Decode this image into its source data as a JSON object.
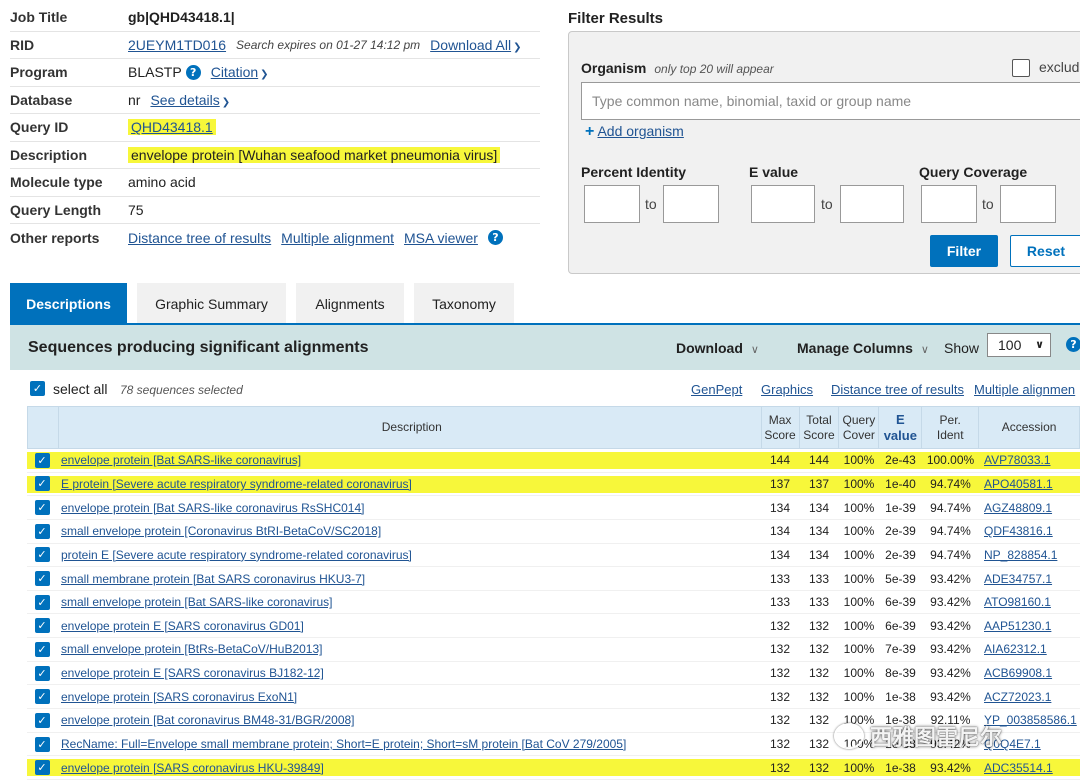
{
  "job": {
    "rows": [
      {
        "label": "Job Title",
        "value": "gb|QHD43418.1|"
      },
      {
        "label": "RID",
        "value": "2UEYM1TD016",
        "note": "Search expires on 01-27 14:12 pm",
        "link": "Download All"
      },
      {
        "label": "Program",
        "value": "BLASTP",
        "link": "Citation"
      },
      {
        "label": "Database",
        "value": "nr",
        "link": "See details"
      },
      {
        "label": "Query ID",
        "value": "QHD43418.1"
      },
      {
        "label": "Description",
        "value": "envelope protein [Wuhan seafood market pneumonia virus]"
      },
      {
        "label": "Molecule type",
        "value": "amino acid"
      },
      {
        "label": "Query Length",
        "value": "75"
      },
      {
        "label": "Other reports",
        "links": [
          "Distance tree of results",
          "Multiple alignment",
          "MSA viewer"
        ]
      }
    ]
  },
  "filter": {
    "title": "Filter Results",
    "organism_label": "Organism",
    "organism_note": "only top 20 will appear",
    "exclude_label": "exclud",
    "organism_placeholder": "Type common  name, binomial, taxid or group  name",
    "add_organism": "Add organism",
    "percent_identity": "Percent Identity",
    "e_value": "E value",
    "query_coverage": "Query Coverage",
    "to": "to",
    "filter_btn": "Filter",
    "reset_btn": "Reset"
  },
  "tabs": [
    "Descriptions",
    "Graphic Summary",
    "Alignments",
    "Taxonomy"
  ],
  "results": {
    "title": "Sequences producing significant alignments",
    "download": "Download",
    "manage_columns": "Manage Columns",
    "show_label": "Show",
    "show_value": "100",
    "select_all": "select all",
    "selected_count": "78 sequences selected",
    "links": [
      "GenPept",
      "Graphics",
      "Distance tree of results",
      "Multiple alignmen"
    ]
  },
  "columns": {
    "description": "Description",
    "max_score": [
      "Max",
      "Score"
    ],
    "total_score": [
      "Total",
      "Score"
    ],
    "query_cover": [
      "Query",
      "Cover"
    ],
    "e_value": [
      "E",
      "value"
    ],
    "per_ident": [
      "Per.",
      "Ident"
    ],
    "accession": "Accession"
  },
  "rows": [
    {
      "desc": "envelope protein [Bat SARS-like coronavirus]",
      "max": "144",
      "total": "144",
      "cover": "100%",
      "e": "2e-43",
      "ident": "100.00%",
      "acc": "AVP78033.1",
      "hl": true
    },
    {
      "desc": "E protein [Severe acute respiratory syndrome-related coronavirus]",
      "max": "137",
      "total": "137",
      "cover": "100%",
      "e": "1e-40",
      "ident": "94.74%",
      "acc": "APO40581.1",
      "hl": true
    },
    {
      "desc": "envelope protein [Bat SARS-like coronavirus RsSHC014]",
      "max": "134",
      "total": "134",
      "cover": "100%",
      "e": "1e-39",
      "ident": "94.74%",
      "acc": "AGZ48809.1",
      "hl": false
    },
    {
      "desc": "small envelope protein [Coronavirus BtRI-BetaCoV/SC2018]",
      "max": "134",
      "total": "134",
      "cover": "100%",
      "e": "2e-39",
      "ident": "94.74%",
      "acc": "QDF43816.1",
      "hl": false
    },
    {
      "desc": "protein E [Severe acute respiratory syndrome-related coronavirus]",
      "max": "134",
      "total": "134",
      "cover": "100%",
      "e": "2e-39",
      "ident": "94.74%",
      "acc": "NP_828854.1",
      "hl": false
    },
    {
      "desc": "small membrane protein [Bat SARS coronavirus HKU3-7]",
      "max": "133",
      "total": "133",
      "cover": "100%",
      "e": "5e-39",
      "ident": "93.42%",
      "acc": "ADE34757.1",
      "hl": false
    },
    {
      "desc": "small envelope protein [Bat SARS-like coronavirus]",
      "max": "133",
      "total": "133",
      "cover": "100%",
      "e": "6e-39",
      "ident": "93.42%",
      "acc": "ATO98160.1",
      "hl": false
    },
    {
      "desc": "envelope protein E [SARS coronavirus GD01]",
      "max": "132",
      "total": "132",
      "cover": "100%",
      "e": "6e-39",
      "ident": "93.42%",
      "acc": "AAP51230.1",
      "hl": false
    },
    {
      "desc": "small envelope protein [BtRs-BetaCoV/HuB2013]",
      "max": "132",
      "total": "132",
      "cover": "100%",
      "e": "7e-39",
      "ident": "93.42%",
      "acc": "AIA62312.1",
      "hl": false
    },
    {
      "desc": "envelope protein E [SARS coronavirus BJ182-12]",
      "max": "132",
      "total": "132",
      "cover": "100%",
      "e": "8e-39",
      "ident": "93.42%",
      "acc": "ACB69908.1",
      "hl": false
    },
    {
      "desc": "envelope protein [SARS coronavirus ExoN1]",
      "max": "132",
      "total": "132",
      "cover": "100%",
      "e": "1e-38",
      "ident": "93.42%",
      "acc": "ACZ72023.1",
      "hl": false
    },
    {
      "desc": "envelope protein [Bat coronavirus BM48-31/BGR/2008]",
      "max": "132",
      "total": "132",
      "cover": "100%",
      "e": "1e-38",
      "ident": "92.11%",
      "acc": "YP_003858586.1",
      "hl": false
    },
    {
      "desc": "RecName: Full=Envelope small membrane protein; Short=E protein; Short=sM protein [Bat CoV 279/2005]",
      "max": "132",
      "total": "132",
      "cover": "100%",
      "e": "1e-38",
      "ident": "93.42%",
      "acc": "Q0Q4E7.1",
      "hl": false
    },
    {
      "desc": "envelope protein [SARS coronavirus HKU-39849]",
      "max": "132",
      "total": "132",
      "cover": "100%",
      "e": "1e-38",
      "ident": "93.42%",
      "acc": "ADC35514.1",
      "hl": true
    }
  ],
  "watermark": "西雅图雷尼尔",
  "colors": {
    "accent": "#0071bc",
    "link": "#205493",
    "highlight": "#f7f73a",
    "header_bg": "#cfe3e4"
  }
}
